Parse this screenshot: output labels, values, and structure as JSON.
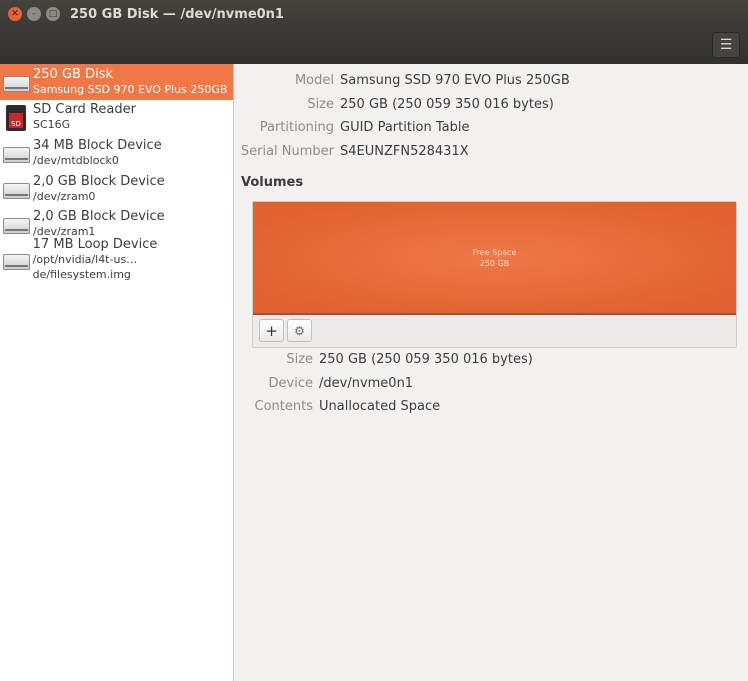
{
  "window": {
    "title": "250 GB Disk — /dev/nvme0n1",
    "menu_icon": "☰"
  },
  "sidebar": {
    "items": [
      {
        "name": "250 GB Disk",
        "sub": "Samsung SSD 970 EVO Plus 250GB",
        "icon": "hard-disk-icon"
      },
      {
        "name": "SD Card Reader",
        "sub": "SC16G",
        "icon": "sd-card-icon",
        "icon_text": "SD"
      },
      {
        "name": "34 MB Block Device",
        "sub": "/dev/mtdblock0",
        "icon": "drive-icon"
      },
      {
        "name": "2,0 GB Block Device",
        "sub": "/dev/zram0",
        "icon": "drive-icon"
      },
      {
        "name": "2,0 GB Block Device",
        "sub": "/dev/zram1",
        "icon": "drive-icon"
      },
      {
        "name": "17 MB Loop Device",
        "sub": "/opt/nvidia/l4t-us…de/filesystem.img",
        "icon": "drive-icon"
      }
    ]
  },
  "disk": {
    "model_label": "Model",
    "model": "Samsung SSD 970 EVO Plus 250GB",
    "size_label": "Size",
    "size": "250 GB (250 059 350 016 bytes)",
    "partitioning_label": "Partitioning",
    "partitioning": "GUID Partition Table",
    "serial_label": "Serial Number",
    "serial": "S4EUNZFN528431X"
  },
  "volumes": {
    "heading": "Volumes",
    "partition_name": "Free Space",
    "partition_size": "250 GB",
    "add": "+",
    "settings": "⚙",
    "size_label": "Size",
    "size": "250 GB (250 059 350 016 bytes)",
    "device_label": "Device",
    "device": "/dev/nvme0n1",
    "contents_label": "Contents",
    "contents": "Unallocated Space"
  },
  "colors": {
    "accent": "#f07746",
    "partition": "#e66a38"
  }
}
